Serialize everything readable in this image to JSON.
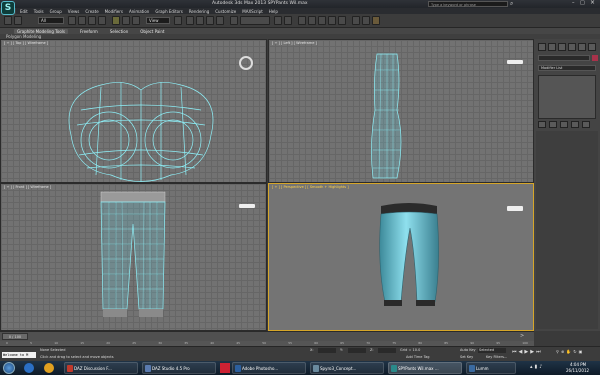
{
  "window": {
    "title": "Autodesk 3ds Max 2013   SPYPants Wil.max",
    "search_placeholder": "Type a keyword or phrase"
  },
  "menu": [
    "Edit",
    "Tools",
    "Group",
    "Views",
    "Create",
    "Modifiers",
    "Animation",
    "Graph Editors",
    "Rendering",
    "Customize",
    "MAXScript",
    "Help"
  ],
  "toolbar": {
    "selection_set": "All",
    "reference_coord": "View"
  },
  "ribbon": {
    "tabs": [
      "Graphite Modeling Tools",
      "Freeform",
      "Selection",
      "Object Paint"
    ],
    "sub": "Polygon Modeling"
  },
  "viewports": [
    {
      "label": "[ + ] [ Top ] [ Wireframe ]",
      "active": false
    },
    {
      "label": "[ + ] [ Left ] [ Wireframe ]",
      "active": false
    },
    {
      "label": "[ + ] [ Front ] [ Wireframe ]",
      "active": false
    },
    {
      "label": "[ + ] [ Perspective ] [ Smooth + Highlights ]",
      "active": true
    }
  ],
  "command_panel": {
    "modifier_list": "Modifier List"
  },
  "timeline": {
    "frame": "0 / 100"
  },
  "track_ticks": [
    "0",
    "5",
    "10",
    "15",
    "20",
    "25",
    "30",
    "35",
    "40",
    "45",
    "50",
    "55",
    "60",
    "65",
    "70",
    "75",
    "80",
    "85",
    "90",
    "95",
    "100"
  ],
  "status": {
    "selection": "None Selected",
    "prompt": "Click and drag to select and move objects",
    "welcome": "Welcome to M",
    "x_label": "X:",
    "y_label": "Y:",
    "z_label": "Z:",
    "grid": "Grid = 10.0",
    "auto_key": "Auto Key",
    "set_key": "Set Key",
    "key_mode": "Selected",
    "key_filters": "Key Filters...",
    "add_time_tag": "Add Time Tag"
  },
  "taskbar": {
    "items": [
      {
        "label": "DAZ Discussion F...",
        "color": "#c0392b"
      },
      {
        "label": "DAZ Studio 4.5 Pro",
        "color": "#5a7bb0"
      },
      {
        "label": "Adobe Photosho...",
        "color": "#2c5f9e"
      },
      {
        "label": "Spyro3_Concept...",
        "color": "#6a8a9e"
      },
      {
        "label": "SPYPants Wil.max ...",
        "color": "#2a8a8a"
      },
      {
        "label": "Lumm",
        "color": "#3a6aa0"
      }
    ],
    "time": "4:04 PM",
    "date": "26/11/2012"
  },
  "colors": {
    "accent_active": "#d6a629",
    "mesh": "#7ee8f2"
  }
}
